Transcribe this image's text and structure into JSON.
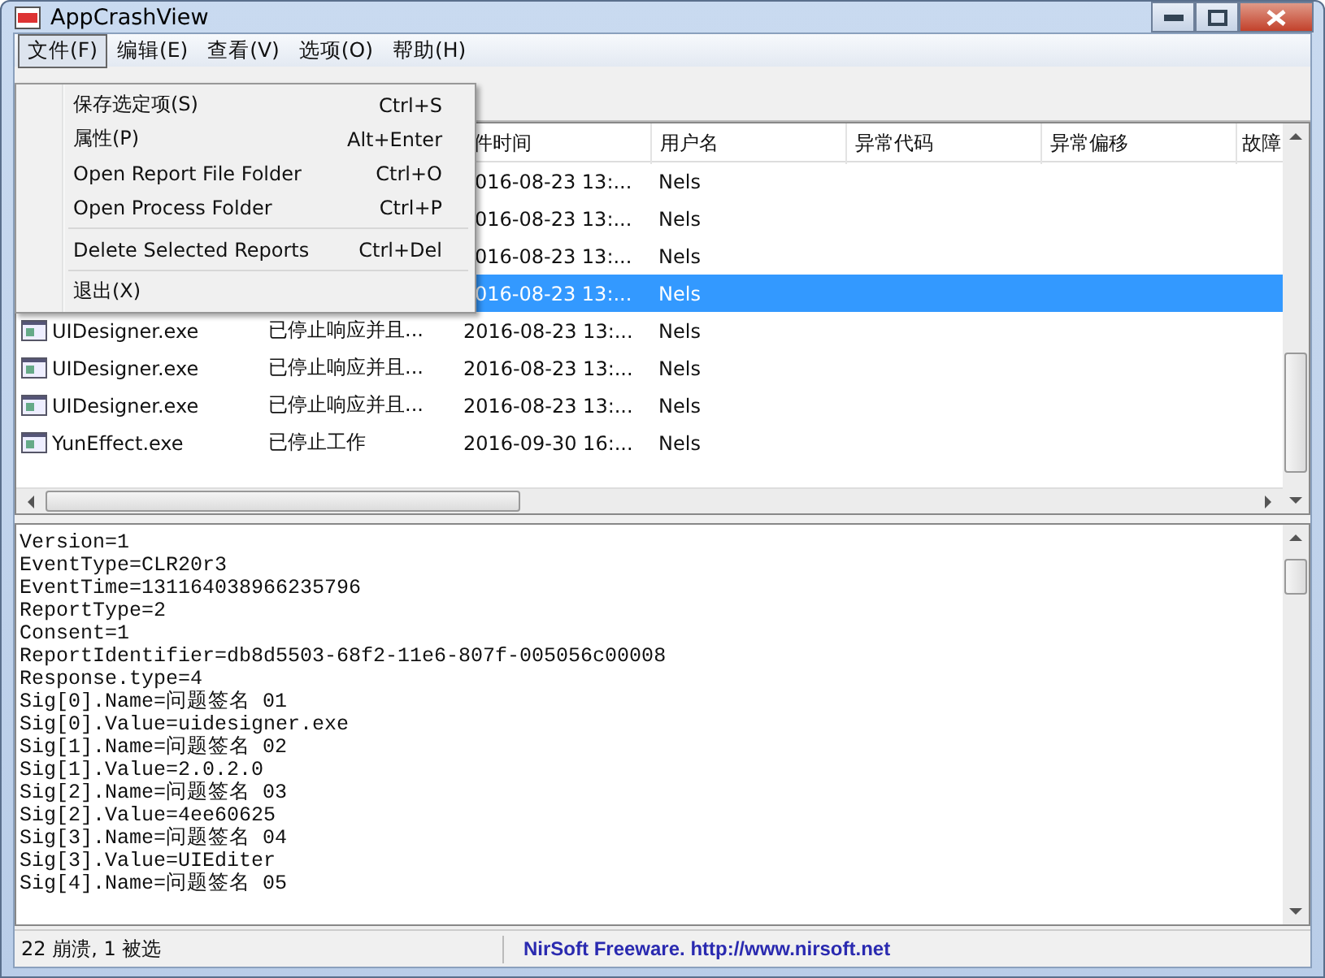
{
  "window": {
    "title": "AppCrashView"
  },
  "menubar": [
    {
      "label": "文件(F)",
      "selected": true
    },
    {
      "label": "编辑(E)",
      "selected": false
    },
    {
      "label": "查看(V)",
      "selected": false
    },
    {
      "label": "选项(O)",
      "selected": false
    },
    {
      "label": "帮助(H)",
      "selected": false
    }
  ],
  "file_menu": {
    "items": [
      {
        "kind": "item",
        "label": "保存选定项(S)",
        "shortcut": "Ctrl+S"
      },
      {
        "kind": "item",
        "label": "属性(P)",
        "shortcut": "Alt+Enter"
      },
      {
        "kind": "item",
        "label": "Open Report File Folder",
        "shortcut": "Ctrl+O"
      },
      {
        "kind": "item",
        "label": "Open Process Folder",
        "shortcut": "Ctrl+P"
      },
      {
        "kind": "separator"
      },
      {
        "kind": "item",
        "label": "Delete Selected Reports",
        "shortcut": "Ctrl+Del"
      },
      {
        "kind": "separator"
      },
      {
        "kind": "item",
        "label": "退出(X)"
      }
    ]
  },
  "table": {
    "columns": [
      "件时间",
      "用户名",
      "异常代码",
      "异常偏移",
      "故障"
    ],
    "rows": [
      {
        "time": "016-08-23 13:...",
        "user": "Nels",
        "selected": false
      },
      {
        "time": "016-08-23 13:...",
        "user": "Nels",
        "selected": false
      },
      {
        "time": "016-08-23 13:...",
        "user": "Nels",
        "selected": false
      },
      {
        "time": "016-08-23 13:...",
        "user": "Nels",
        "selected": true
      },
      {
        "app": "UIDesigner.exe",
        "event": "已停止响应并且...",
        "time": "2016-08-23 13:...",
        "user": "Nels",
        "selected": false
      },
      {
        "app": "UIDesigner.exe",
        "event": "已停止响应并且...",
        "time": "2016-08-23 13:...",
        "user": "Nels",
        "selected": false
      },
      {
        "app": "UIDesigner.exe",
        "event": "已停止响应并且...",
        "time": "2016-08-23 13:...",
        "user": "Nels",
        "selected": false
      },
      {
        "app": "YunEffect.exe",
        "event": "已停止工作",
        "time": "2016-09-30 16:...",
        "user": "Nels",
        "selected": false
      }
    ]
  },
  "details": {
    "lines": [
      "Version=1",
      "EventType=CLR20r3",
      "EventTime=131164038966235796",
      "ReportType=2",
      "Consent=1",
      "ReportIdentifier=db8d5503-68f2-11e6-807f-005056c00008",
      "Response.type=4",
      "Sig[0].Name=问题签名 01",
      "Sig[0].Value=uidesigner.exe",
      "Sig[1].Name=问题签名 02",
      "Sig[1].Value=2.0.2.0",
      "Sig[2].Name=问题签名 03",
      "Sig[2].Value=4ee60625",
      "Sig[3].Name=问题签名 04",
      "Sig[3].Value=UIEditer",
      "Sig[4].Name=问题签名 05"
    ]
  },
  "status_bar": {
    "count": "22 崩溃, 1 被选",
    "credit": "NirSoft Freeware.  http://www.nirsoft.net"
  }
}
